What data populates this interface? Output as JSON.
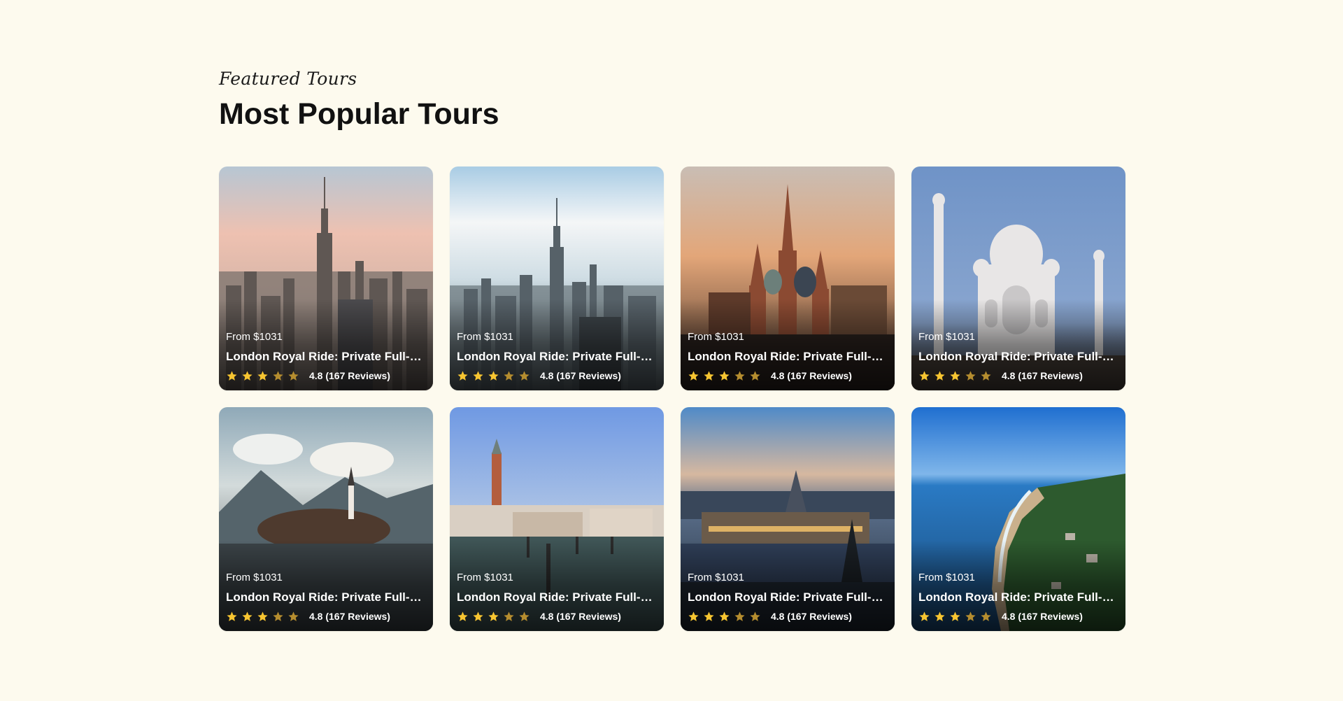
{
  "section": {
    "kicker": "Featured Tours",
    "heading": "Most Popular Tours"
  },
  "tours": [
    {
      "price": "From $1031",
      "title": "London Royal Ride: Private Full-Day Tour",
      "rating": "4.8 (167 Reviews)",
      "stars_filled": 3,
      "scene": "new-york-skyline-dusk"
    },
    {
      "price": "From $1031",
      "title": "London Royal Ride: Private Full-Day Tour",
      "rating": "4.8 (167 Reviews)",
      "stars_filled": 3,
      "scene": "new-york-skyline-fog"
    },
    {
      "price": "From $1031",
      "title": "London Royal Ride: Private Full-Day Tour",
      "rating": "4.8 (167 Reviews)",
      "stars_filled": 3,
      "scene": "moscow-st-basils-cathedral"
    },
    {
      "price": "From $1031",
      "title": "London Royal Ride: Private Full-Day Tour",
      "rating": "4.8 (167 Reviews)",
      "stars_filled": 3,
      "scene": "taj-mahal"
    },
    {
      "price": "From $1031",
      "title": "London Royal Ride: Private Full-Day Tour",
      "rating": "4.8 (167 Reviews)",
      "stars_filled": 3,
      "scene": "lake-bled-church"
    },
    {
      "price": "From $1031",
      "title": "London Royal Ride: Private Full-Day Tour",
      "rating": "4.8 (167 Reviews)",
      "stars_filled": 3,
      "scene": "venice-san-marco"
    },
    {
      "price": "From $1031",
      "title": "London Royal Ride: Private Full-Day Tour",
      "rating": "4.8 (167 Reviews)",
      "stars_filled": 3,
      "scene": "budapest-parliament-night"
    },
    {
      "price": "From $1031",
      "title": "London Royal Ride: Private Full-Day Tour",
      "rating": "4.8 (167 Reviews)",
      "stars_filled": 3,
      "scene": "tropical-coastline"
    }
  ],
  "colors": {
    "background": "#fdfaee",
    "star_filled": "#f7c531",
    "star_empty": "#b58d2f",
    "text_on_image": "#ffffff"
  }
}
